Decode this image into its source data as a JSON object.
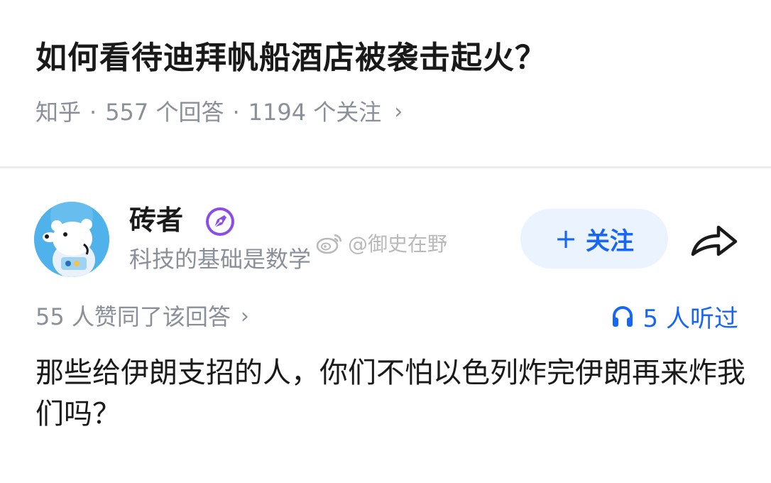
{
  "question": {
    "title": "如何看待迪拜帆船酒店被袭击起火？",
    "source": "知乎",
    "answers": "557 个回答",
    "followers": "1194 个关注",
    "separator": "·",
    "chevron": "›"
  },
  "answer": {
    "author": {
      "name": "砖者",
      "bio": "科技的基础是数学",
      "badge_icon": "pen-badge-icon",
      "avatar_icon": "polar-bear-avatar"
    },
    "follow_plus": "+",
    "follow_label": "关注",
    "share_icon": "share-arrow-icon",
    "upvotes_text": "55 人赞同了该回答",
    "upvotes_chevron": "›",
    "listeners_text": "5 人听过",
    "listeners_icon": "headphones-icon",
    "content": "那些给伊朗支招的人，你们不怕以色列炸完伊朗再来炸我们吗？"
  },
  "watermark": {
    "text": "@御史在野",
    "icon": "weibo-icon"
  },
  "colors": {
    "accent": "#1766f5",
    "follow_bg": "#ebf3ff",
    "meta_gray": "#8a8f99",
    "badge_purple": "#8a4ee6",
    "avatar_blue": "#4fb2ea"
  }
}
